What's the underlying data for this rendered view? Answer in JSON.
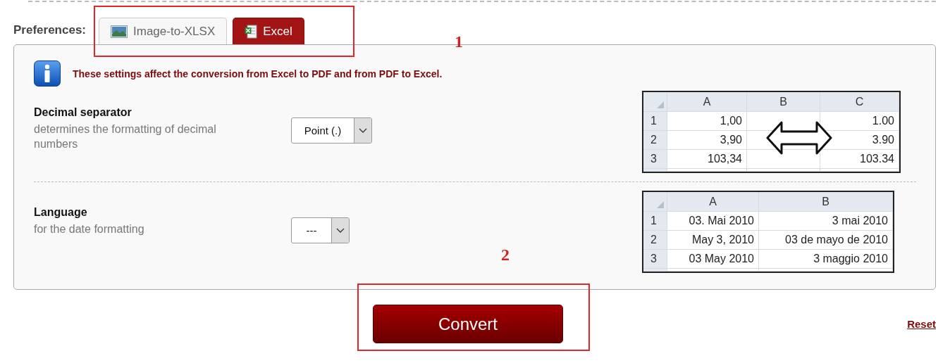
{
  "preferences_label": "Preferences:",
  "tabs": [
    {
      "label": "Image-to-XLSX",
      "kind": "image",
      "selected": false
    },
    {
      "label": "Excel",
      "kind": "excel",
      "selected": true
    }
  ],
  "info": "These settings affect the conversion from Excel to PDF and from PDF to Excel.",
  "settings": [
    {
      "label": "Decimal separator",
      "description": "determines the formatting of decimal numbers",
      "value": "Point (.)",
      "example": {
        "arrow": true,
        "columns": [
          "A",
          "B",
          "C"
        ],
        "rows": [
          {
            "number": "1",
            "cells": [
              "1,00",
              null,
              "1.00"
            ]
          },
          {
            "number": "2",
            "cells": [
              "3,90",
              null,
              "3.90"
            ]
          },
          {
            "number": "3",
            "cells": [
              "103,34",
              null,
              "103.34"
            ]
          }
        ]
      }
    },
    {
      "label": "Language",
      "description": "for the date formatting",
      "value": "---",
      "example": {
        "arrow": false,
        "columns": [
          "A",
          "B"
        ],
        "rows": [
          {
            "number": "1",
            "cells": [
              "03. Mai 2010",
              "3 mai 2010"
            ]
          },
          {
            "number": "2",
            "cells": [
              "May 3, 2010",
              "03 de mayo de 2010"
            ]
          },
          {
            "number": "3",
            "cells": [
              "03 May 2010",
              "3 maggio 2010"
            ]
          }
        ]
      }
    }
  ],
  "convert_button": "Convert",
  "reset_link": "Reset",
  "annotations": [
    {
      "label": "1"
    },
    {
      "label": "2"
    }
  ]
}
